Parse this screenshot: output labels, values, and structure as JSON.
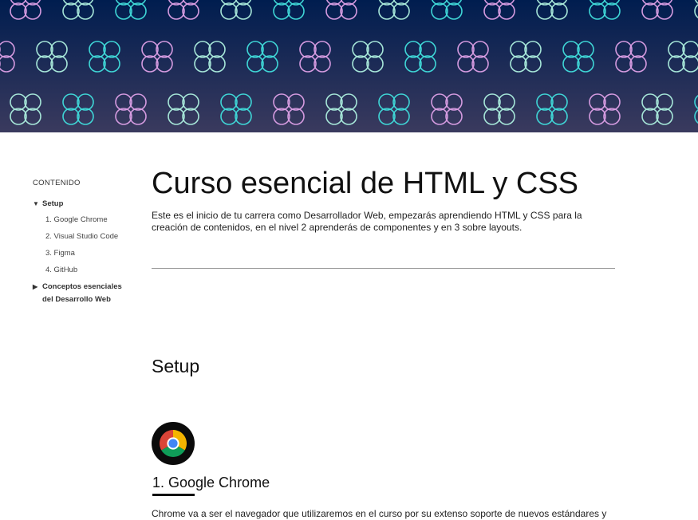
{
  "hero": {
    "gradient_top": "#001d4f",
    "gradient_bottom": "#3a3a5e",
    "pattern_colors": [
      "#3fd6d6",
      "#d59be0",
      "#a6e6d8"
    ]
  },
  "sidebar": {
    "toc_title": "CONTENIDO",
    "sections": [
      {
        "label": "Setup",
        "expanded": true,
        "icon": "triangle-down-icon",
        "items": [
          {
            "label": "1. Google Chrome"
          },
          {
            "label": "2. Visual Studio Code"
          },
          {
            "label": "3. Figma"
          },
          {
            "label": "4. GitHub"
          }
        ]
      },
      {
        "label": "Conceptos esenciales del Desarrollo Web",
        "expanded": false,
        "icon": "triangle-right-icon"
      }
    ]
  },
  "main": {
    "title": "Curso esencial de HTML y CSS",
    "intro": "Este es el inicio de tu carrera como Desarrollador Web, empezarás aprendiendo HTML y CSS para la creación de contenidos, en el nivel 2 aprenderás de componentes y en 3 sobre layouts.",
    "section_heading": "Setup",
    "subsection": {
      "icon": "chrome-icon",
      "heading": "1. Google Chrome",
      "text": "Chrome va a ser el navegador que utilizaremos en el curso por su extenso soporte de nuevos estándares y"
    }
  }
}
